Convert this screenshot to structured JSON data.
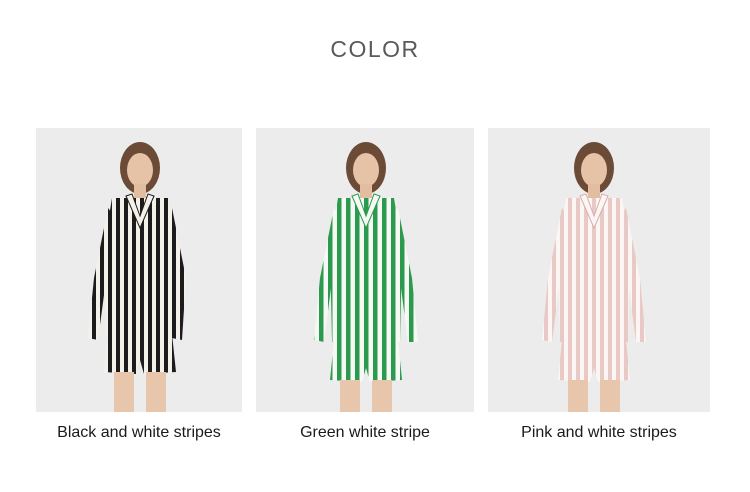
{
  "section_title": "COLOR",
  "variants": [
    {
      "caption": "Black and white stripes",
      "stripe_color": "#1c1c1c",
      "base_color": "#f4f1ea",
      "image": "model-black-white-stripes"
    },
    {
      "caption": "Green white stripe",
      "stripe_color": "#2c9a4e",
      "base_color": "#f6f8f4",
      "image": "model-green-white-stripes"
    },
    {
      "caption": "Pink and white stripes",
      "stripe_color": "#e8c9c6",
      "base_color": "#fbf5f3",
      "image": "model-pink-white-stripes"
    }
  ]
}
